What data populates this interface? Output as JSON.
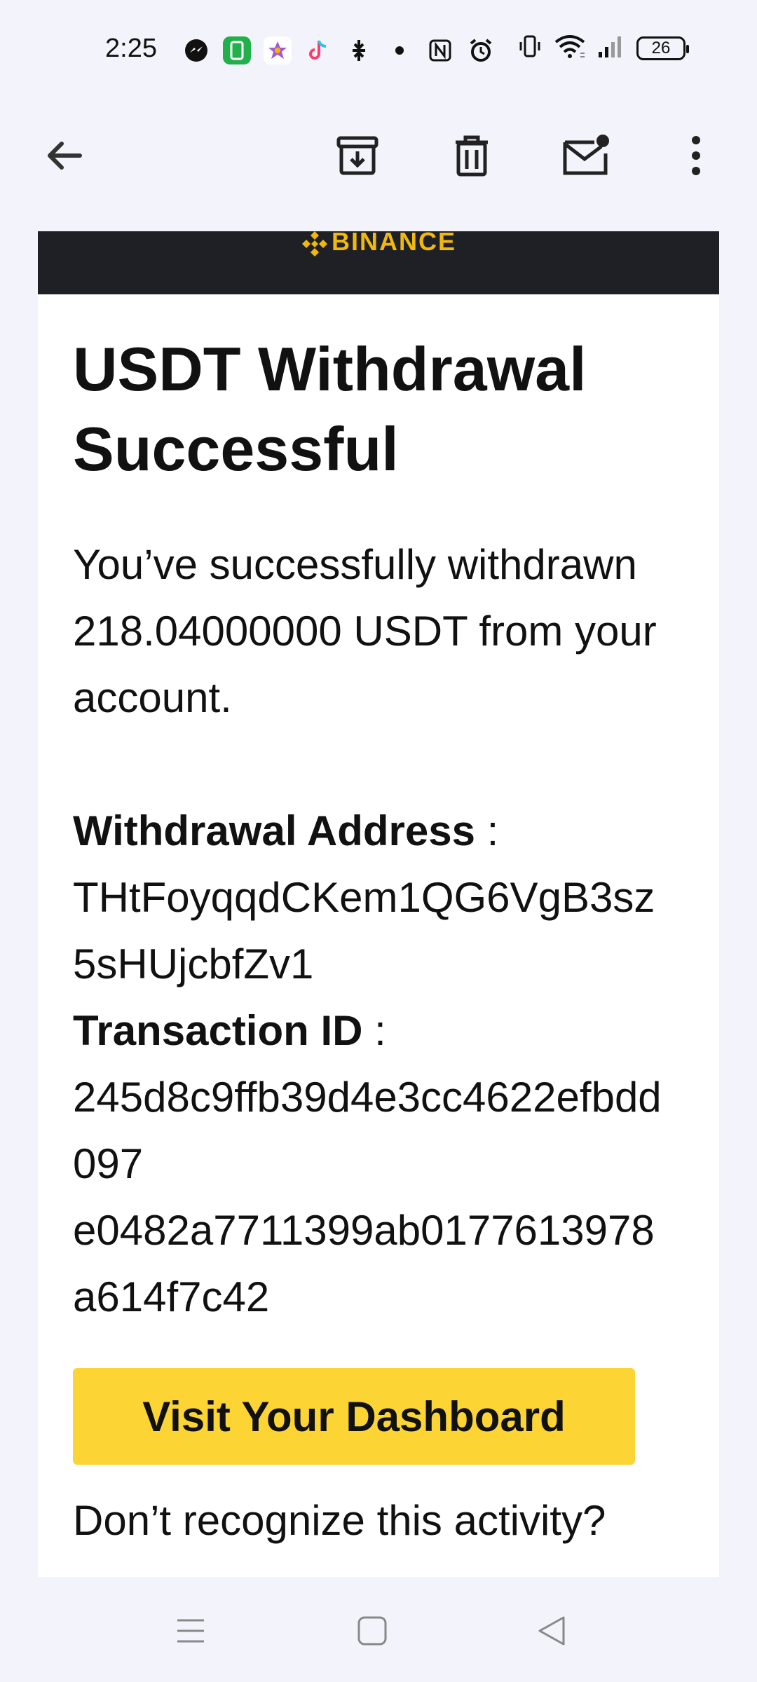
{
  "status_bar": {
    "time": "2:25",
    "battery": "26",
    "icons": [
      "messenger-icon",
      "app-green-icon",
      "star-app-icon",
      "tiktok-icon",
      "pinch-icon",
      "dot-icon",
      "nfc-icon",
      "alarm-icon",
      "vibrate-icon",
      "wifi-icon",
      "signal-icon"
    ]
  },
  "email": {
    "brand": "BINANCE",
    "title": "USDT Withdrawal Successful",
    "intro": "You’ve successfully withdrawn 218.04000000 USDT from your account.",
    "address_label": "Withdrawal Address",
    "address_value": "THtFoyqqdCKem1QG6VgB3sz5sHUjcbfZv1",
    "txid_label": "Transaction ID",
    "txid_value_line1": "245d8c9ffb39d4e3cc4622efbdd097",
    "txid_value_line2": "e0482a7711399ab0177613978a614f7c42",
    "separator": " :",
    "cta_label": "Visit Your Dashboard",
    "footer": "Don’t recognize this activity?"
  },
  "colors": {
    "brand_yellow": "#f0b90b",
    "cta_yellow": "#fcd535",
    "header_dark": "#1e2026",
    "background": "#f3f3fb"
  }
}
